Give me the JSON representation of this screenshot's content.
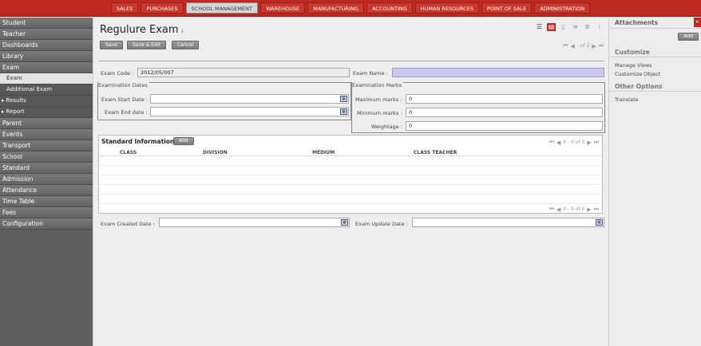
{
  "topnav": {
    "items": [
      {
        "label": "SALES"
      },
      {
        "label": "PURCHASES"
      },
      {
        "label": "SCHOOL MANAGEMENT"
      },
      {
        "label": "WAREHOUSE"
      },
      {
        "label": "MANUFACTURING"
      },
      {
        "label": "ACCOUNTING"
      },
      {
        "label": "HUMAN RESOURCES"
      },
      {
        "label": "POINT OF SALE"
      },
      {
        "label": "ADMINISTRATION"
      }
    ],
    "active_index": 2
  },
  "sidebar": {
    "items": [
      {
        "label": "Student",
        "type": "section"
      },
      {
        "label": "Teacher",
        "type": "section"
      },
      {
        "label": "Dashboards",
        "type": "section"
      },
      {
        "label": "Library",
        "type": "section"
      },
      {
        "label": "Exam",
        "type": "section"
      },
      {
        "label": "Exam",
        "type": "sub",
        "active": true
      },
      {
        "label": "Additional Exam",
        "type": "sub"
      },
      {
        "label": "Results",
        "type": "sub",
        "arrow": true
      },
      {
        "label": "Report",
        "type": "sub",
        "arrow": true
      },
      {
        "label": "Parent",
        "type": "section"
      },
      {
        "label": "Events",
        "type": "section"
      },
      {
        "label": "Transport",
        "type": "section"
      },
      {
        "label": "School",
        "type": "section"
      },
      {
        "label": "Standard",
        "type": "section"
      },
      {
        "label": "Admission",
        "type": "section"
      },
      {
        "label": "Attendance",
        "type": "section"
      },
      {
        "label": "Time Table",
        "type": "section"
      },
      {
        "label": "Fees",
        "type": "section"
      },
      {
        "label": "Configuration",
        "type": "section"
      }
    ]
  },
  "main": {
    "title": "Regulure Exam",
    "title_icon": "↓",
    "buttons": {
      "save": "Save",
      "save_edit": "Save & Edit",
      "cancel": "Cancel"
    },
    "pager": {
      "first": "⏮",
      "prev": "◀",
      "text": "- of 2",
      "next": "▶",
      "last": "⏭"
    },
    "view_icons": [
      "list-view-icon",
      "form-view-icon",
      "calendar-view-icon",
      "graph-view-icon",
      "gantt-view-icon",
      "diagram-view-icon"
    ],
    "exam_code": {
      "label": "Exam Code :",
      "value": "2012/05/007"
    },
    "exam_name": {
      "label": "Exam Name :",
      "value": ""
    },
    "exam_dates": {
      "title": "Examination Dates",
      "start_label": "Exam Start Date :",
      "start_value": "",
      "end_label": "Exam End date :",
      "end_value": ""
    },
    "exam_marks": {
      "title": "Examination Marks",
      "max_label": "Maximum marks :",
      "max_value": "0",
      "min_label": "Minimum marks :",
      "min_value": "0",
      "weight_label": "Weightage :",
      "weight_value": "0"
    },
    "standard": {
      "title": "Standard Information",
      "add_label": "Add",
      "columns": [
        "CLASS",
        "DIVISION",
        "MEDIUM",
        "CLASS TEACHER"
      ],
      "pager_text": "0 - 0 of 0"
    },
    "created": {
      "label": "Exam Created Date :",
      "value": ""
    },
    "updated": {
      "label": "Exam Update Date :",
      "value": ""
    },
    "calendar_glyph": "▦"
  },
  "right_panel": {
    "attachments": "Attachments",
    "collapse": "»",
    "add": "Add",
    "customize": "Customize",
    "manage_views": "Manage Views",
    "customize_object": "Customize Object",
    "other_options": "Other Options",
    "translate": "Translate"
  },
  "colors": {
    "brand_red": "#bd2a22",
    "required_field": "#c8c8f0",
    "sidebar_bg": "#5f5f5f"
  }
}
